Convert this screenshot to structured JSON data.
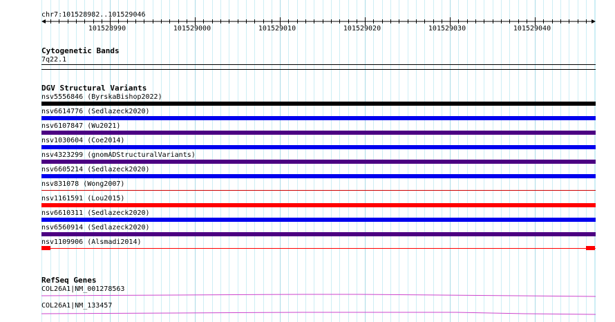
{
  "ruler": {
    "location": "chr7:101528982..101529046",
    "ticks": [
      "101528990",
      "101529000",
      "101529010",
      "101529020",
      "101529030",
      "101529040"
    ]
  },
  "cytoband": {
    "title": "Cytogenetic Bands",
    "band": "7q22.1"
  },
  "dgv": {
    "title": "DGV Structural Variants",
    "variants": [
      {
        "label": "nsv5556846 (ByrskaBishop2022)",
        "color": "#000000",
        "style": "thick"
      },
      {
        "label": "nsv6614776 (Sedlazeck2020)",
        "color": "#0000ee",
        "style": "thick"
      },
      {
        "label": "nsv6107847 (Wu2021)",
        "color": "#4b0082",
        "style": "thick"
      },
      {
        "label": "nsv1030604 (Coe2014)",
        "color": "#0000ee",
        "style": "thick"
      },
      {
        "label": "nsv4323299 (gnomADStructuralVariants)",
        "color": "#4b0082",
        "style": "thick"
      },
      {
        "label": "nsv6605214 (Sedlazeck2020)",
        "color": "#0000ee",
        "style": "thick"
      },
      {
        "label": "nsv831078 (Wong2007)",
        "color": "#cc0000",
        "style": "thin"
      },
      {
        "label": "nsv1161591 (Lou2015)",
        "color": "#ff0000",
        "style": "thick"
      },
      {
        "label": "nsv6610311 (Sedlazeck2020)",
        "color": "#0000ee",
        "style": "thick"
      },
      {
        "label": "nsv6560914 (Sedlazeck2020)",
        "color": "#4b0082",
        "style": "thick"
      },
      {
        "label": "nsv1109906 (Alsmadi2014)",
        "color": "#ff0000",
        "style": "thin-ends"
      }
    ]
  },
  "refseq": {
    "title": "RefSeq Genes",
    "genes": [
      {
        "label": "COL26A1|NM_001278563",
        "color": "#cc44cc"
      },
      {
        "label": "COL26A1|NM_133457",
        "color": "#cc44cc"
      }
    ]
  },
  "colors": {
    "grid_minor": "#cdeef5",
    "grid_major": "#a9dbe6"
  }
}
